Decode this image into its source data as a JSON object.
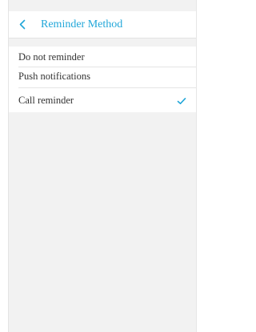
{
  "header": {
    "title": "Reminder Method",
    "back_icon": "chevron-left-icon"
  },
  "reminder_options": [
    {
      "label": "Do not reminder",
      "selected": false
    },
    {
      "label": "Push notifications",
      "selected": false
    },
    {
      "label": "Call reminder",
      "selected": true
    }
  ],
  "colors": {
    "accent": "#22a7d9",
    "background": "#f2f2f2",
    "text": "#333333"
  },
  "icons": {
    "selected": "checkmark-icon"
  }
}
